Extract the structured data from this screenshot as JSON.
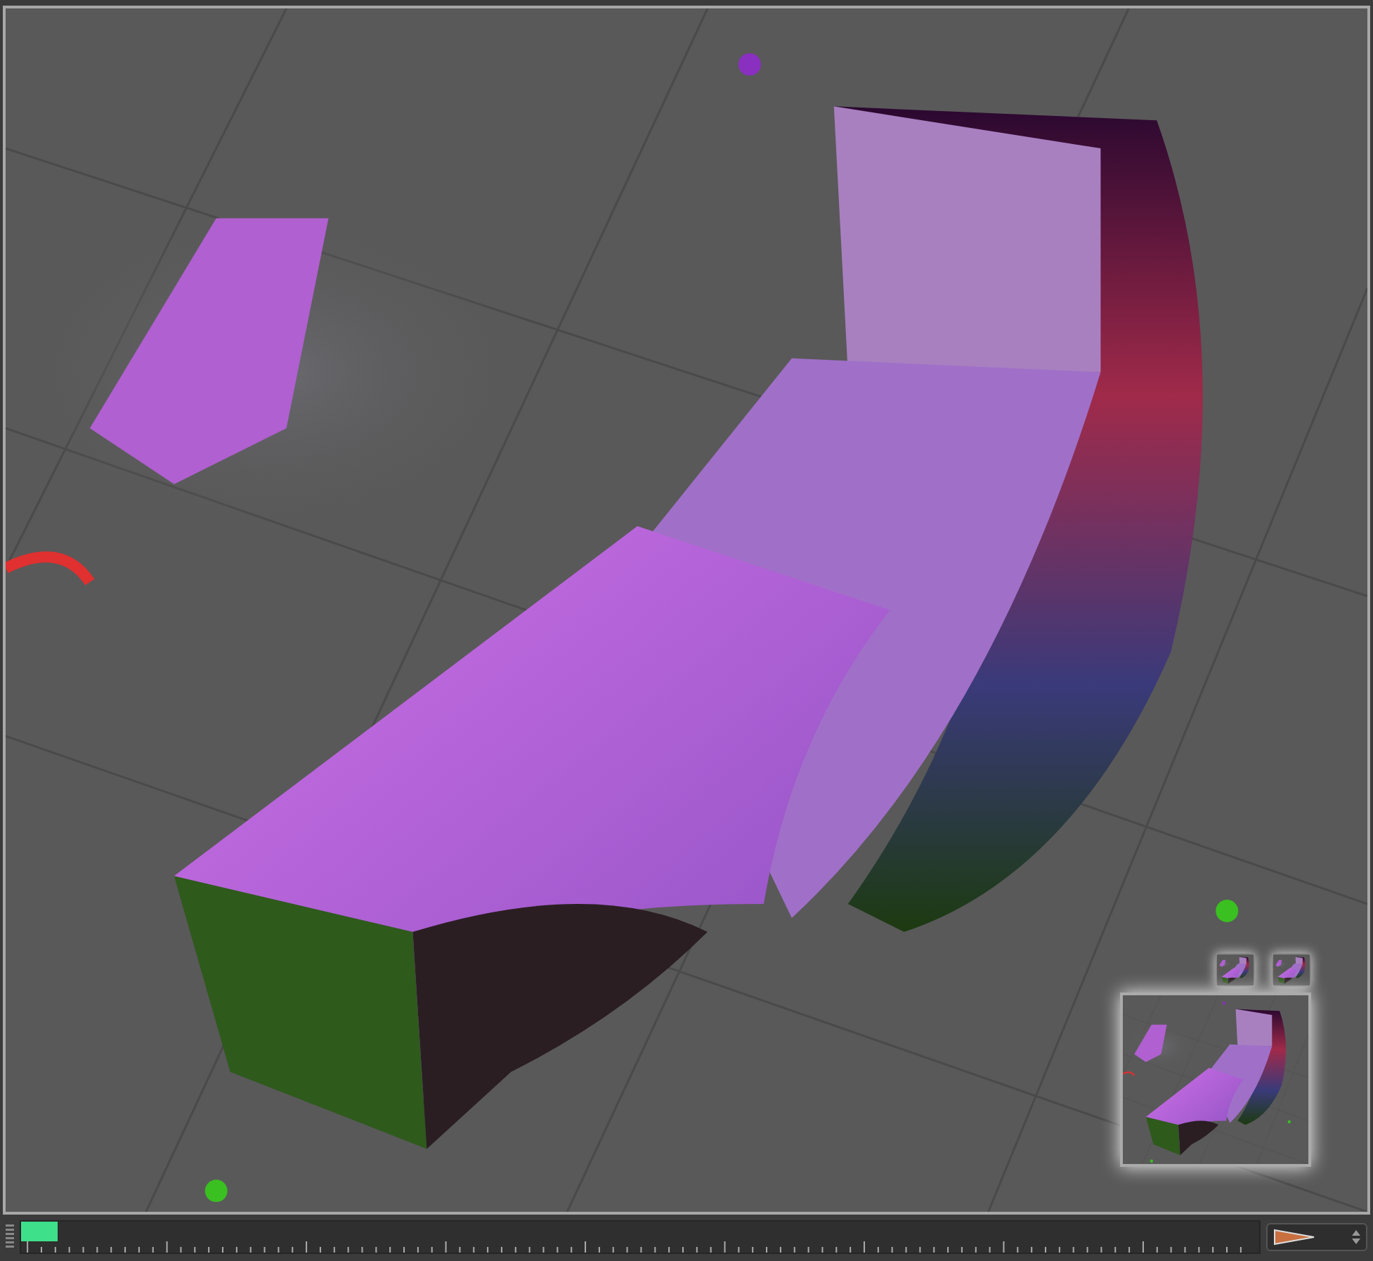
{
  "timeline": {
    "level": 0.03
  }
}
